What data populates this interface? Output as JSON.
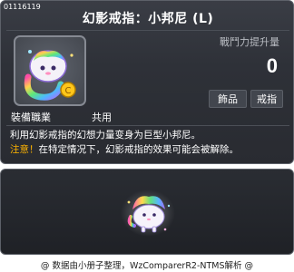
{
  "item": {
    "id": "01116119",
    "title": "幻影戒指：小邦尼 (L)",
    "attack_label": "戰鬥力提升量",
    "attack_value": "0",
    "tags": [
      "飾品",
      "戒指"
    ],
    "job_label": "裝備職業",
    "job_value": "共用",
    "description": "利用幻影戒指的幻想力量变身为巨型小邦尼。",
    "note_prefix": "注意！",
    "note_text": "在特定情况下，幻影戒指的效果可能会被解除。"
  },
  "footer": "@ 数据由小册子整理，WzComparerR2-NTMS解析 @",
  "colors": {
    "card_bg": "#2e3138",
    "note_accent": "#ffb400",
    "text": "#ffffff"
  },
  "icons": {
    "item_icon": "rainbow-ring-icon",
    "preview": "rainbow-bunny-sprite"
  }
}
